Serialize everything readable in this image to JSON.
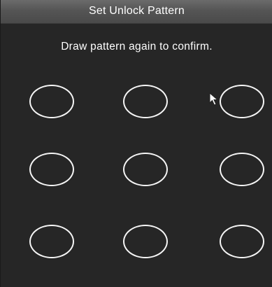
{
  "dialog": {
    "title": "Set Unlock Pattern",
    "instruction": "Draw pattern again to confirm."
  },
  "pattern": {
    "rows": 3,
    "columns": 3,
    "nodes": [
      {
        "row": 1,
        "column": 1
      },
      {
        "row": 1,
        "column": 2
      },
      {
        "row": 1,
        "column": 3
      },
      {
        "row": 2,
        "column": 1
      },
      {
        "row": 2,
        "column": 2
      },
      {
        "row": 2,
        "column": 3
      },
      {
        "row": 3,
        "column": 1
      },
      {
        "row": 3,
        "column": 2
      },
      {
        "row": 3,
        "column": 3
      }
    ]
  },
  "colors": {
    "background": "#262626",
    "titlebar": "#555555",
    "node_stroke": "#f5f5f5",
    "text": "#ffffff"
  },
  "icons": {
    "cursor": "mouse-pointer-icon"
  }
}
